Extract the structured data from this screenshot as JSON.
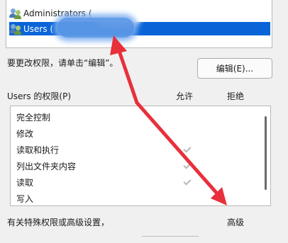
{
  "group_list": {
    "items": [
      {
        "label": "Administrators (",
        "selected": false
      },
      {
        "label": "Users (",
        "selected": true
      }
    ]
  },
  "instruction_text": "要更改权限，请单击“编辑”。",
  "edit_button": "编辑(E)...",
  "permissions": {
    "title": "Users 的权限(P)",
    "allow_header": "允许",
    "deny_header": "拒绝",
    "rows": [
      {
        "label": "完全控制",
        "allow": false
      },
      {
        "label": "修改",
        "allow": false
      },
      {
        "label": "读取和执行",
        "allow": true
      },
      {
        "label": "列出文件夹内容",
        "allow": true
      },
      {
        "label": "读取",
        "allow": true
      },
      {
        "label": "写入",
        "allow": false
      }
    ]
  },
  "footer_text": "有关特殊权限或高级设置，",
  "advanced_button": "高级",
  "colors": {
    "selection": "#0a64d8",
    "arrow": "#e8303b",
    "check": "#b8b8b8"
  }
}
